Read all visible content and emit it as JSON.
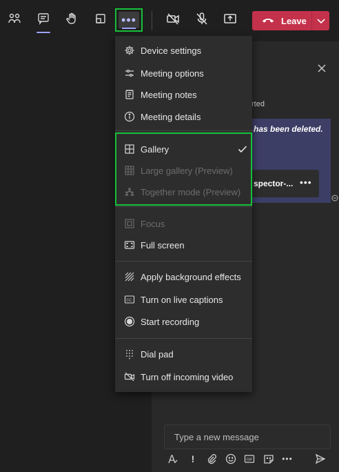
{
  "toolbar": {
    "buttons": [
      {
        "name": "people-icon"
      },
      {
        "name": "chat-icon"
      },
      {
        "name": "raise-hand-icon"
      },
      {
        "name": "breakout-rooms-icon"
      },
      {
        "name": "more-actions-icon",
        "label": "•••"
      },
      {
        "name": "camera-off-icon"
      },
      {
        "name": "mic-off-icon"
      },
      {
        "name": "share-screen-icon"
      }
    ],
    "leave_label": "Leave"
  },
  "menu": {
    "items": [
      {
        "label": "Device settings",
        "icon": "gear-icon"
      },
      {
        "label": "Meeting options",
        "icon": "sliders-icon"
      },
      {
        "label": "Meeting notes",
        "icon": "notes-icon"
      },
      {
        "label": "Meeting details",
        "icon": "info-icon"
      },
      {
        "label": "Gallery",
        "icon": "grid-icon",
        "checked": true
      },
      {
        "label": "Large gallery (Preview)",
        "icon": "large-grid-icon",
        "disabled": true
      },
      {
        "label": "Together mode (Preview)",
        "icon": "together-mode-icon",
        "disabled": true
      },
      {
        "label": "Focus",
        "icon": "focus-icon",
        "disabled": true
      },
      {
        "label": "Full screen",
        "icon": "full-screen-icon"
      },
      {
        "label": "Apply background effects",
        "icon": "background-effects-icon"
      },
      {
        "label": "Turn on live captions",
        "icon": "captions-icon"
      },
      {
        "label": "Start recording",
        "icon": "record-icon"
      },
      {
        "label": "Dial pad",
        "icon": "dial-pad-icon"
      },
      {
        "label": "Turn off incoming video",
        "icon": "video-off-icon"
      }
    ]
  },
  "chat": {
    "partial_text": "rted",
    "deleted_message": "has been deleted.",
    "inspector_card_text": "spector-...",
    "inspector_more": "•••",
    "compose_placeholder": "Type a new message"
  },
  "colors": {
    "accent": "#9ea2ff",
    "leave": "#c4314b",
    "highlight": "#16c23a",
    "menu_bg": "#2d2d2d",
    "background": "#1f1f1f"
  }
}
